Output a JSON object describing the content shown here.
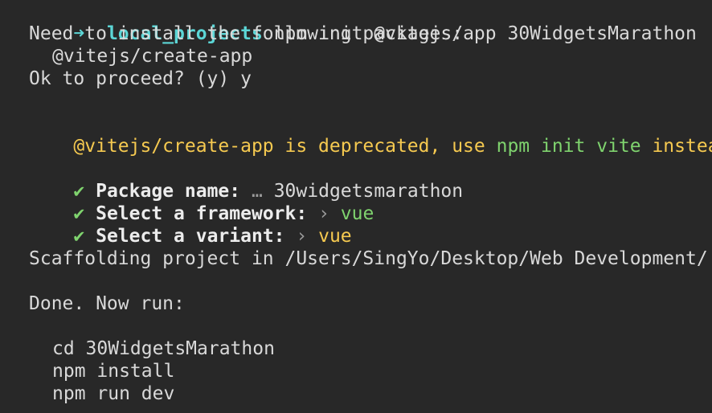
{
  "terminal": {
    "prompt": {
      "arrow": "➜",
      "directory": "local_projects",
      "command": "npm init @vitejs/app 30WidgetsMarathon"
    },
    "install_notice": "Need to install the following packages:",
    "install_package": "@vitejs/create-app",
    "proceed_question": "Ok to proceed? (y) y",
    "deprecation": {
      "prefix": "@vitejs/create-app is deprecated, use ",
      "command": "npm init vite",
      "suffix": " instead"
    },
    "answers": [
      {
        "check": "✔",
        "label": "Package name:",
        "separator": "…",
        "value": "30widgetsmarathon"
      },
      {
        "check": "✔",
        "label": "Select a framework:",
        "separator": "›",
        "value": "vue"
      },
      {
        "check": "✔",
        "label": "Select a variant:",
        "separator": "›",
        "value": "vue"
      }
    ],
    "scaffolding": "Scaffolding project in /Users/SingYo/Desktop/Web Development/",
    "done": "Done. Now run:",
    "next_commands": [
      "cd 30WidgetsMarathon",
      "npm install",
      "npm run dev"
    ]
  },
  "colors": {
    "background": "#282828",
    "text": "#d9d9d9",
    "prompt_cyan": "#5cd6d6",
    "warning_yellow": "#f5c950",
    "success_green": "#7fd36e",
    "dim_gray": "#9a9a9a"
  }
}
